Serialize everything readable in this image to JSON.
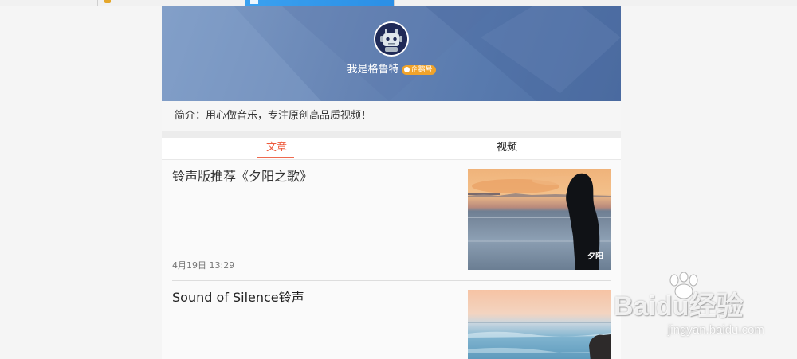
{
  "profile": {
    "name": "我是格鲁特",
    "badge": "企鹅号",
    "intro": "简介：用心做音乐，专注原创高品质视频！"
  },
  "tabs": [
    {
      "label": "文章",
      "active": true
    },
    {
      "label": "视频",
      "active": false
    }
  ],
  "articles": [
    {
      "title": "铃声版推荐《夕阳之歌》",
      "date": "4月19日 13:29",
      "thumbnail": "sunset-silhouette",
      "thumbnail_caption": "夕阳"
    },
    {
      "title": "Sound of Silence铃声",
      "thumbnail": "sea-rocks-dusk"
    }
  ],
  "watermark": {
    "brand": "Baidu经验",
    "url": "jingyan.baidu.com"
  },
  "colors": {
    "banner": "#6684b4",
    "accent_tab": "#ee5a3c",
    "badge": "#f0a32a",
    "browser_tab_active": "#3aa1f0"
  }
}
